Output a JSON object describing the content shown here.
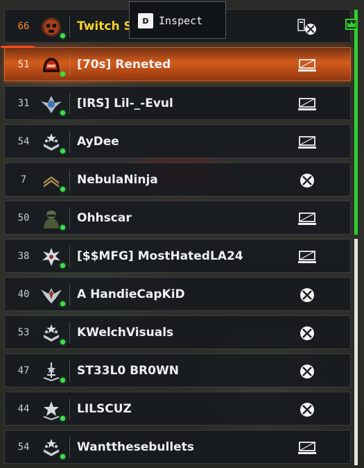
{
  "tooltip": {
    "key": "D",
    "label": "Inspect"
  },
  "colors": {
    "online": "#3fe04a",
    "party": "#2fd12f",
    "highlight": "#e0601e",
    "gold_name": "#f7d22a"
  },
  "players": [
    {
      "level": "66",
      "name": "Twitch Sw",
      "emblem": "skull-emblem",
      "platform": "battlenet-xbox-icon"
    },
    {
      "level": "51",
      "name": "[70s] Reneted",
      "emblem": "red-helmet-emblem",
      "platform": "pc-icon"
    },
    {
      "level": "31",
      "name": "[IRS] Lil-_-Evul",
      "emblem": "winged-star-emblem",
      "platform": "pc-icon"
    },
    {
      "level": "54",
      "name": "AyDee",
      "emblem": "rank-stars-emblem",
      "platform": "pc-icon"
    },
    {
      "level": "7",
      "name": "NebulaNinja",
      "emblem": "chevron-rank-emblem",
      "platform": "xbox-icon"
    },
    {
      "level": "50",
      "name": "Ohhscar",
      "emblem": "soldier-emblem",
      "platform": "pc-icon"
    },
    {
      "level": "38",
      "name": "[$$MFG] MostHatedLA24",
      "emblem": "star-burst-emblem",
      "platform": "pc-icon"
    },
    {
      "level": "40",
      "name": "A HandieCapKiD",
      "emblem": "eagle-emblem",
      "platform": "xbox-icon"
    },
    {
      "level": "53",
      "name": "KWelchVisuals",
      "emblem": "rank-stars-emblem",
      "platform": "xbox-icon"
    },
    {
      "level": "47",
      "name": "ST33L0 BR0WN",
      "emblem": "sword-star-emblem",
      "platform": "xbox-icon"
    },
    {
      "level": "44",
      "name": "LILSCUZ",
      "emblem": "star-rank-emblem",
      "platform": "xbox-icon"
    },
    {
      "level": "54",
      "name": "Wantthesebullets",
      "emblem": "rank-stars-emblem",
      "platform": "pc-icon"
    }
  ]
}
